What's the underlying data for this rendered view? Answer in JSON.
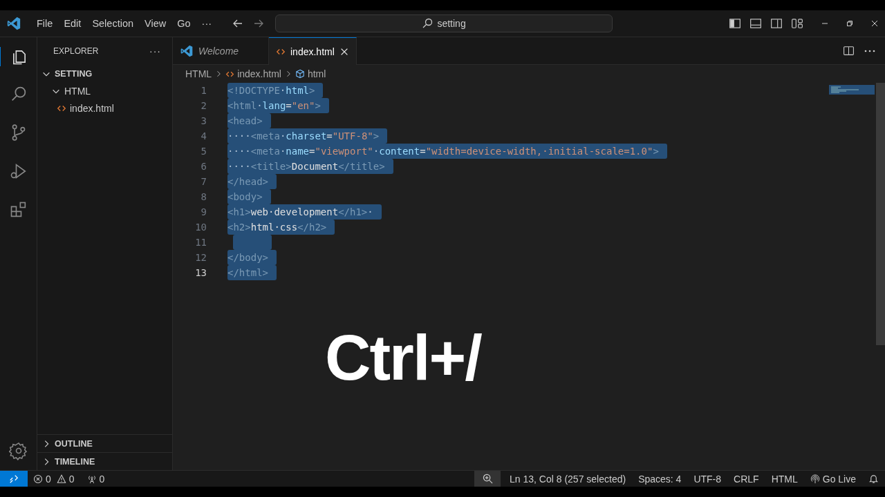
{
  "menu": [
    "File",
    "Edit",
    "Selection",
    "View",
    "Go",
    "···"
  ],
  "search": {
    "value": "setting"
  },
  "sidebar": {
    "title": "EXPLORER",
    "more": "···",
    "tree": [
      {
        "label": "SETTING",
        "kind": "root",
        "expanded": true,
        "children": [
          {
            "label": "HTML",
            "kind": "folder",
            "expanded": true,
            "children": [
              {
                "label": "index.html",
                "kind": "file"
              }
            ]
          }
        ]
      }
    ],
    "sections": [
      {
        "label": "OUTLINE",
        "expanded": false
      },
      {
        "label": "TIMELINE",
        "expanded": false
      }
    ]
  },
  "tabs": [
    {
      "label": "Welcome",
      "kind": "welcome",
      "selected": false
    },
    {
      "label": "index.html",
      "kind": "html",
      "selected": true
    }
  ],
  "breadcrumbs": [
    {
      "label": "HTML",
      "kind": "folder"
    },
    {
      "label": "index.html",
      "kind": "html"
    },
    {
      "label": "html",
      "kind": "element"
    }
  ],
  "code_lines": [
    {
      "number": "1",
      "selected": true,
      "current": false,
      "tokens": [
        {
          "kind": "tag",
          "text": "<!DOCTYPE"
        },
        {
          "kind": "ws",
          "text": "·"
        },
        {
          "kind": "attr",
          "text": "html"
        },
        {
          "kind": "tag",
          "text": ">"
        }
      ]
    },
    {
      "number": "2",
      "selected": true,
      "current": false,
      "tokens": [
        {
          "kind": "tag",
          "text": "<html"
        },
        {
          "kind": "ws",
          "text": "·"
        },
        {
          "kind": "attr",
          "text": "lang"
        },
        {
          "kind": "text",
          "text": "="
        },
        {
          "kind": "str",
          "text": "\"en\""
        },
        {
          "kind": "tag",
          "text": ">"
        }
      ]
    },
    {
      "number": "3",
      "selected": true,
      "current": false,
      "tokens": [
        {
          "kind": "tag",
          "text": "<head>"
        }
      ]
    },
    {
      "number": "4",
      "selected": true,
      "current": false,
      "tokens": [
        {
          "kind": "ws",
          "text": "····"
        },
        {
          "kind": "tag",
          "text": "<meta"
        },
        {
          "kind": "ws",
          "text": "·"
        },
        {
          "kind": "attr",
          "text": "charset"
        },
        {
          "kind": "text",
          "text": "="
        },
        {
          "kind": "str",
          "text": "\"UTF-8\""
        },
        {
          "kind": "tag",
          "text": ">"
        }
      ]
    },
    {
      "number": "5",
      "selected": true,
      "current": false,
      "tokens": [
        {
          "kind": "ws",
          "text": "····"
        },
        {
          "kind": "tag",
          "text": "<meta"
        },
        {
          "kind": "ws",
          "text": "·"
        },
        {
          "kind": "attr",
          "text": "name"
        },
        {
          "kind": "text",
          "text": "="
        },
        {
          "kind": "str",
          "text": "\"viewport\""
        },
        {
          "kind": "ws",
          "text": "·"
        },
        {
          "kind": "attr",
          "text": "content"
        },
        {
          "kind": "text",
          "text": "="
        },
        {
          "kind": "str",
          "text": "\"width=device-width,·initial-scale=1.0\""
        },
        {
          "kind": "tag",
          "text": ">"
        }
      ]
    },
    {
      "number": "6",
      "selected": true,
      "current": false,
      "tokens": [
        {
          "kind": "ws",
          "text": "····"
        },
        {
          "kind": "tag",
          "text": "<title>"
        },
        {
          "kind": "text",
          "text": "Document"
        },
        {
          "kind": "tag",
          "text": "</title>"
        }
      ]
    },
    {
      "number": "7",
      "selected": true,
      "current": false,
      "tokens": [
        {
          "kind": "tag",
          "text": "</head>"
        }
      ]
    },
    {
      "number": "8",
      "selected": true,
      "current": false,
      "tokens": [
        {
          "kind": "tag",
          "text": "<body>"
        }
      ]
    },
    {
      "number": "9",
      "selected": true,
      "current": false,
      "tokens": [
        {
          "kind": "tag",
          "text": "<h1>"
        },
        {
          "kind": "text",
          "text": "web·development"
        },
        {
          "kind": "tag",
          "text": "</h1>"
        },
        {
          "kind": "ws",
          "text": "·"
        }
      ]
    },
    {
      "number": "10",
      "selected": true,
      "current": false,
      "tokens": [
        {
          "kind": "tag",
          "text": "<h2>"
        },
        {
          "kind": "text",
          "text": "html·css"
        },
        {
          "kind": "tag",
          "text": "</h2>"
        }
      ]
    },
    {
      "number": "11",
      "selected": true,
      "current": false
    },
    {
      "number": "12",
      "selected": true,
      "current": false,
      "tokens": [
        {
          "kind": "tag",
          "text": "</body>"
        }
      ]
    },
    {
      "number": "13",
      "selected": true,
      "current": true,
      "tokens": [
        {
          "kind": "tag",
          "text": "</html>"
        }
      ]
    }
  ],
  "overlay_caption": "Ctrl+/",
  "status_bar": {
    "left": [
      {
        "kind": "errors",
        "text": "0"
      },
      {
        "kind": "warnings",
        "text": "0"
      },
      {
        "kind": "ports",
        "text": "0"
      }
    ],
    "right": [
      {
        "kind": "zoom"
      },
      {
        "kind": "text",
        "text": "Ln 13, Col 8 (257 selected)"
      },
      {
        "kind": "text",
        "text": "Spaces: 4"
      },
      {
        "kind": "text",
        "text": "UTF-8"
      },
      {
        "kind": "text",
        "text": "CRLF"
      },
      {
        "kind": "text",
        "text": "HTML"
      },
      {
        "kind": "golive",
        "text": "Go Live"
      },
      {
        "kind": "bell"
      }
    ]
  }
}
